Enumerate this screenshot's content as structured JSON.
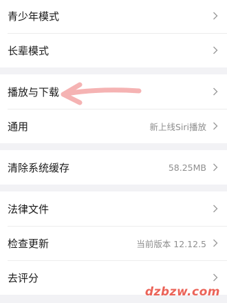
{
  "sections": [
    {
      "rows": [
        {
          "label": "青少年模式",
          "value": ""
        },
        {
          "label": "长辈模式",
          "value": ""
        }
      ]
    },
    {
      "rows": [
        {
          "label": "播放与下载",
          "value": ""
        },
        {
          "label": "通用",
          "value": "新上线Siri播放"
        }
      ]
    },
    {
      "rows": [
        {
          "label": "清除系统缓存",
          "value": "58.25MB"
        }
      ]
    },
    {
      "rows": [
        {
          "label": "法律文件",
          "value": ""
        },
        {
          "label": "检查更新",
          "value": "当前版本 12.12.5"
        },
        {
          "label": "去评分",
          "value": ""
        }
      ]
    }
  ],
  "annotation": {
    "icon": "arrow-left-icon",
    "color": "#f5b3b3"
  },
  "watermark": "dzbzw.com",
  "colors": {
    "background": "#f2f2f5",
    "row": "#ffffff",
    "text": "#1a1a1a",
    "secondary": "#8e8e8e"
  }
}
